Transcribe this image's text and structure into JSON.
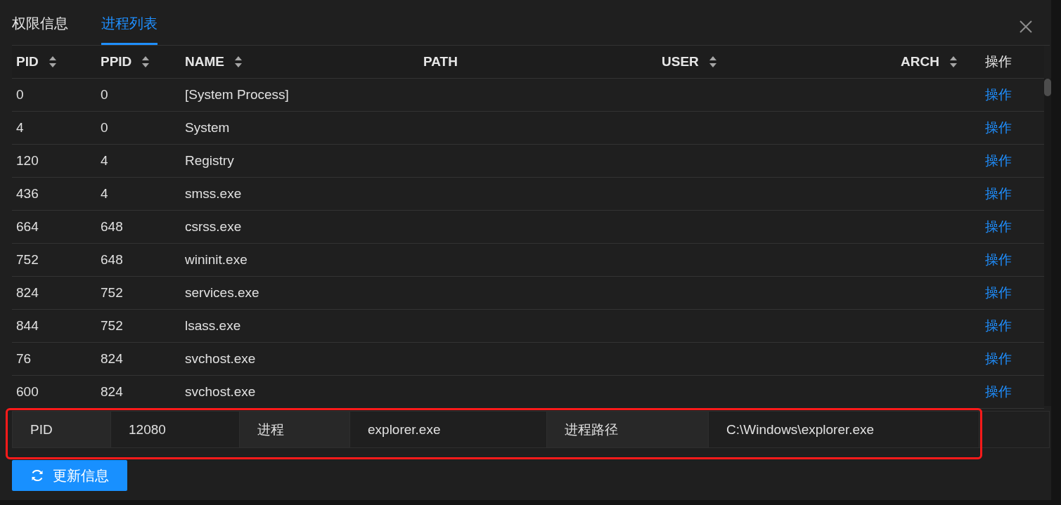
{
  "tabs": [
    {
      "label": "权限信息",
      "selected": false
    },
    {
      "label": "进程列表",
      "selected": true
    }
  ],
  "table": {
    "columns": [
      {
        "label": "PID",
        "sortable": true
      },
      {
        "label": "PPID",
        "sortable": true
      },
      {
        "label": "NAME",
        "sortable": true
      },
      {
        "label": "PATH",
        "sortable": false
      },
      {
        "label": "USER",
        "sortable": true
      },
      {
        "label": "ARCH",
        "sortable": true
      },
      {
        "label": "操作",
        "sortable": false
      }
    ],
    "rows": [
      {
        "pid": "0",
        "ppid": "0",
        "name": "[System Process]",
        "action": "操作"
      },
      {
        "pid": "4",
        "ppid": "0",
        "name": "System",
        "action": "操作"
      },
      {
        "pid": "120",
        "ppid": "4",
        "name": "Registry",
        "action": "操作"
      },
      {
        "pid": "436",
        "ppid": "4",
        "name": "smss.exe",
        "action": "操作"
      },
      {
        "pid": "664",
        "ppid": "648",
        "name": "csrss.exe",
        "action": "操作"
      },
      {
        "pid": "752",
        "ppid": "648",
        "name": "wininit.exe",
        "action": "操作"
      },
      {
        "pid": "824",
        "ppid": "752",
        "name": "services.exe",
        "action": "操作"
      },
      {
        "pid": "844",
        "ppid": "752",
        "name": "lsass.exe",
        "action": "操作"
      },
      {
        "pid": "76",
        "ppid": "824",
        "name": "svchost.exe",
        "action": "操作"
      },
      {
        "pid": "600",
        "ppid": "824",
        "name": "svchost.exe",
        "action": "操作"
      }
    ]
  },
  "info": [
    {
      "label": "PID",
      "value": "12080"
    },
    {
      "label": "进程",
      "value": "explorer.exe"
    },
    {
      "label": "进程路径",
      "value": "C:\\Windows\\explorer.exe"
    }
  ],
  "refresh_button": {
    "label": "更新信息"
  }
}
